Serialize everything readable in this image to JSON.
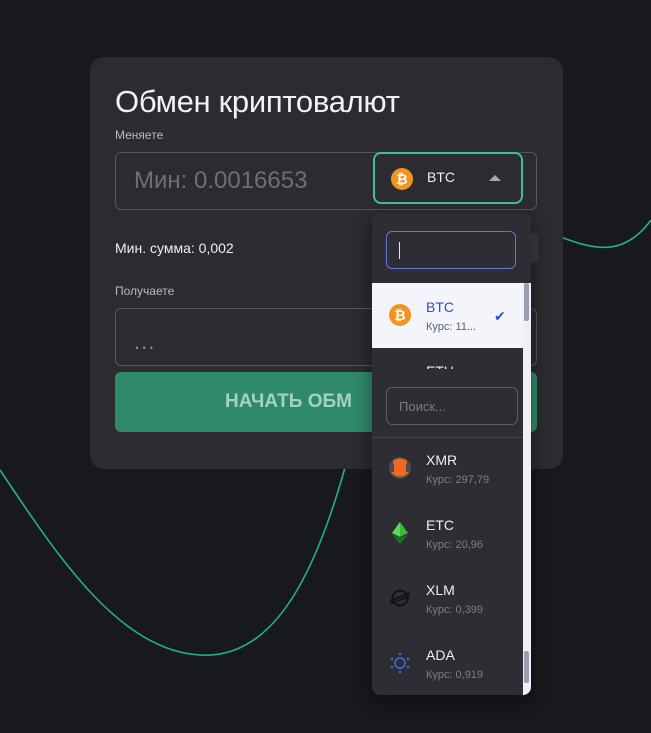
{
  "title": "Обмен криптовалют",
  "give": {
    "label": "Меняете",
    "amount": "Мин: 0.0016653",
    "selected_currency": "BTC",
    "selected_icon": "bitcoin-icon"
  },
  "min_sum": "Мин. сумма: 0,002",
  "get": {
    "label": "Получаете",
    "amount": "..."
  },
  "start_button": "НАЧАТЬ ОБМ",
  "dropdown": {
    "search_placeholder": "Поиск...",
    "peek_label": "ETH",
    "selected": {
      "code": "BTC",
      "rate": "Курс: 11...",
      "icon": "bitcoin-icon",
      "check": "✔"
    },
    "items": [
      {
        "code": "XMR",
        "rate": "Курс: 297,79",
        "icon": "monero-icon"
      },
      {
        "code": "ETC",
        "rate": "Курс: 20,96",
        "icon": "ethereum-classic-icon"
      },
      {
        "code": "XLM",
        "rate": "Курс: 0,399",
        "icon": "stellar-icon"
      },
      {
        "code": "ADA",
        "rate": "Курс: 0,919",
        "icon": "cardano-icon"
      }
    ]
  },
  "colors": {
    "background": "#18191c",
    "card": "#2b2b30",
    "accent": "#3fbf98",
    "button": "#2f8a6c",
    "bitcoin": "#f39321",
    "monero": "#f26822",
    "etc": "#3ab83a",
    "selected_text": "#2f4fc2"
  }
}
